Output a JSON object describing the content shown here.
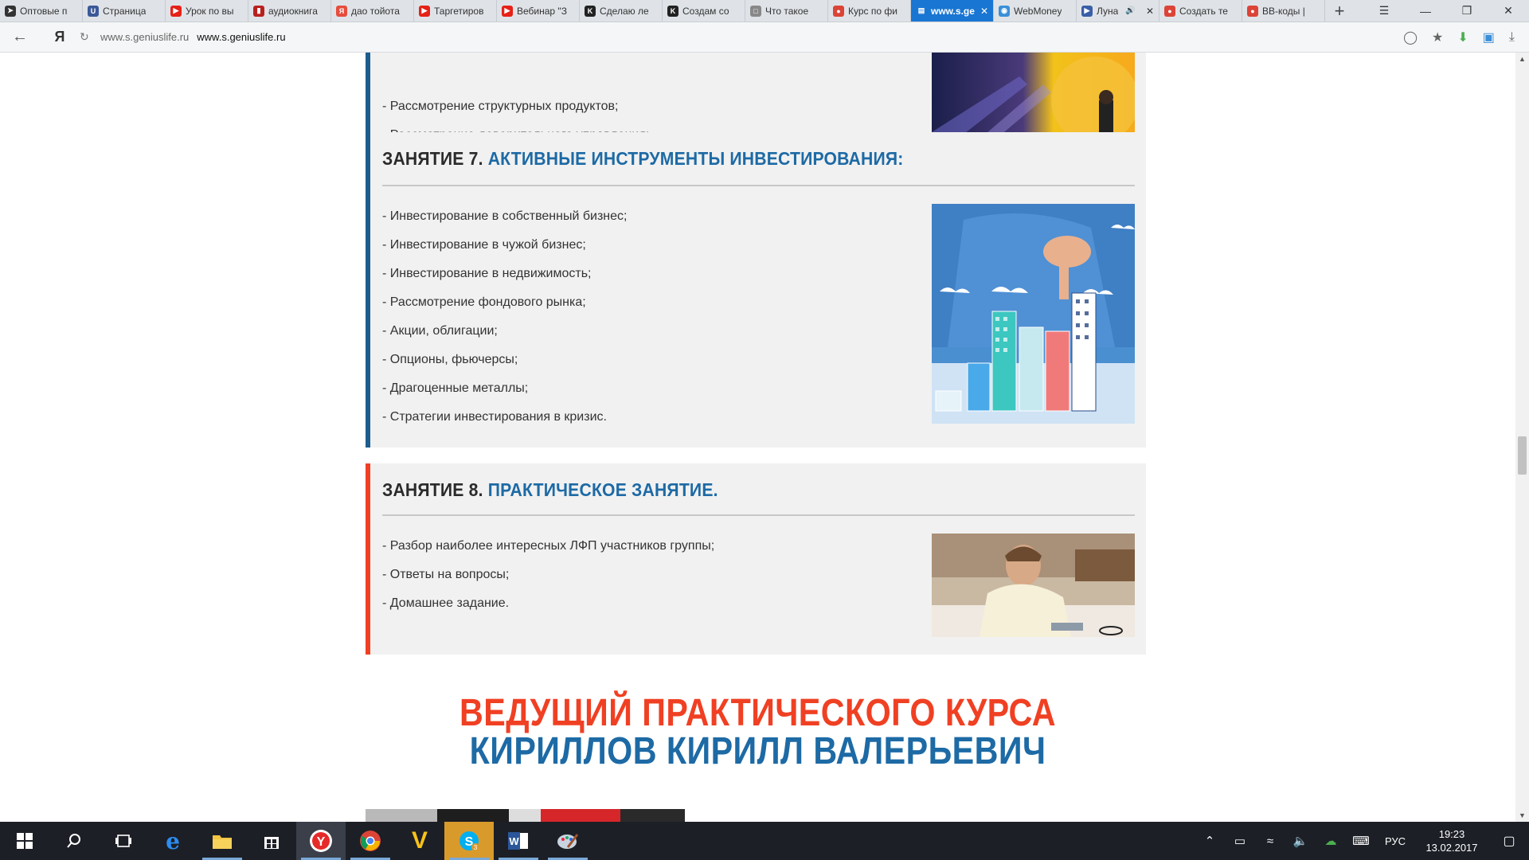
{
  "browser": {
    "tabs": [
      {
        "title": "Оптовые п",
        "icon": "arrow-icon",
        "color": "#333333"
      },
      {
        "title": "Страница",
        "icon": "ups-icon",
        "color": "#3b5998"
      },
      {
        "title": "Урок по вы",
        "icon": "youtube-icon",
        "color": "#e62117"
      },
      {
        "title": "аудиокнига",
        "icon": "book-icon",
        "color": "#b8201e"
      },
      {
        "title": "дао тойота",
        "icon": "yandex-icon",
        "color": "#e74c3c"
      },
      {
        "title": "Таргетиров",
        "icon": "youtube-icon",
        "color": "#e62117"
      },
      {
        "title": "Вебинар \"З",
        "icon": "youtube-icon",
        "color": "#e62117"
      },
      {
        "title": "Сделаю ле",
        "icon": "k-icon",
        "color": "#222222"
      },
      {
        "title": "Создам со",
        "icon": "k-icon",
        "color": "#222222"
      },
      {
        "title": "Что такое",
        "icon": "page-icon",
        "color": "#888888"
      },
      {
        "title": "Курс по фи",
        "icon": "chrome-icon",
        "color": "#db4437"
      },
      {
        "title": "www.s.ge",
        "icon": "document-icon",
        "color": "#ffffff",
        "active": true
      },
      {
        "title": "WebMoney",
        "icon": "globe-icon",
        "color": "#3a8fd8"
      },
      {
        "title": "Луна",
        "icon": "play-icon",
        "color": "#3a5ea8",
        "audio": true
      },
      {
        "title": "Создать те",
        "icon": "chrome-icon",
        "color": "#db4437"
      },
      {
        "title": "BB-коды |",
        "icon": "chrome-icon",
        "color": "#db4437"
      }
    ],
    "address": {
      "host": "www.s.geniuslife.ru",
      "title": "www.s.geniuslife.ru"
    }
  },
  "lessons": {
    "lesson6_tail": {
      "items": [
        "- Рассмотрение структурных продуктов;",
        "- Рассмотрение доверительного управления;"
      ]
    },
    "lesson7": {
      "number": "ЗАНЯТИЕ 7.",
      "name": "АКТИВНЫЕ ИНСТРУМЕНТЫ ИНВЕСТИРОВАНИЯ:",
      "items": [
        "- Инвестирование в собственный бизнес;",
        "- Инвестирование в чужой бизнес;",
        "- Инвестирование в недвижимость;",
        "- Рассмотрение фондового рынка;",
        "- Акции, облигации;",
        "- Опционы, фьючерсы;",
        "- Драгоценные металлы;",
        "- Стратегии инвестирования в кризис."
      ]
    },
    "lesson8": {
      "number": "ЗАНЯТИЕ 8.",
      "name": "ПРАКТИЧЕСКОЕ ЗАНЯТИЕ.",
      "items": [
        "- Разбор наиболее интересных ЛФП участников группы;",
        "- Ответы на вопросы;",
        "- Домашнее задание."
      ]
    }
  },
  "host_section": {
    "line1": "ВЕДУЩИЙ ПРАКТИЧЕСКОГО КУРСА",
    "line2": "КИРИЛЛОВ КИРИЛЛ ВАЛЕРЬЕВИЧ"
  },
  "colors": {
    "accent_blue": "#1d6aa5",
    "accent_red": "#f04023",
    "active_tab": "#1976d2"
  },
  "taskbar": {
    "apps": [
      "windows-start-icon",
      "search-icon",
      "task-view-icon",
      "edge-icon",
      "file-explorer-icon",
      "store-icon",
      "yandex-browser-icon",
      "chrome-icon",
      "vivaldi-icon",
      "skype-icon",
      "word-icon",
      "paint-icon"
    ],
    "tray": {
      "language": "РУС",
      "time": "19:23",
      "date": "13.02.2017"
    }
  }
}
